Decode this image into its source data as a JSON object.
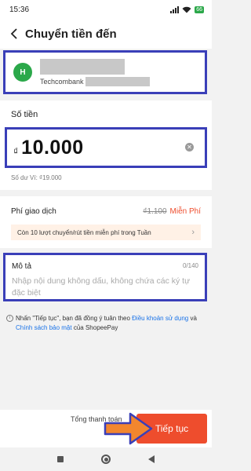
{
  "status_bar": {
    "time": "15:36",
    "battery": "66"
  },
  "header": {
    "title": "Chuyển tiền đến"
  },
  "recipient": {
    "avatar_initial": "H",
    "bank": "Techcombank"
  },
  "amount": {
    "label": "Số tiền",
    "currency_symbol": "₫",
    "value": "10.000",
    "balance": "Số dư Ví: ₫19.000"
  },
  "fee": {
    "label": "Phí giao dịch",
    "original": "₫1.100",
    "free_label": "Miễn Phí",
    "promo_text": "Còn 10 lượt chuyển/rút tiền miễn phí trong Tuần"
  },
  "description": {
    "label": "Mô tả",
    "counter": "0/140",
    "value": "",
    "placeholder": "Nhập nội dung không dấu, không chứa các ký tự đặc biệt"
  },
  "terms": {
    "prefix": "Nhấn \"Tiếp tục\", bạn đã đồng ý tuân theo ",
    "link1": "Điều khoản sử dụng",
    "mid": " và ",
    "link2": "Chính sách bảo mật",
    "suffix": " của ShopeePay"
  },
  "footer": {
    "total_label": "Tổng thanh toán",
    "continue_label": "Tiếp tục"
  },
  "colors": {
    "accent": "#ee4d2d",
    "highlight_border": "#3a3fb8",
    "arrow": "#f2862e",
    "avatar": "#2ba84a",
    "link": "#1a73e8"
  },
  "icons": [
    "chevron-left-icon",
    "clear-icon",
    "chevron-right-icon",
    "info-icon",
    "arrow-overlay-icon"
  ]
}
